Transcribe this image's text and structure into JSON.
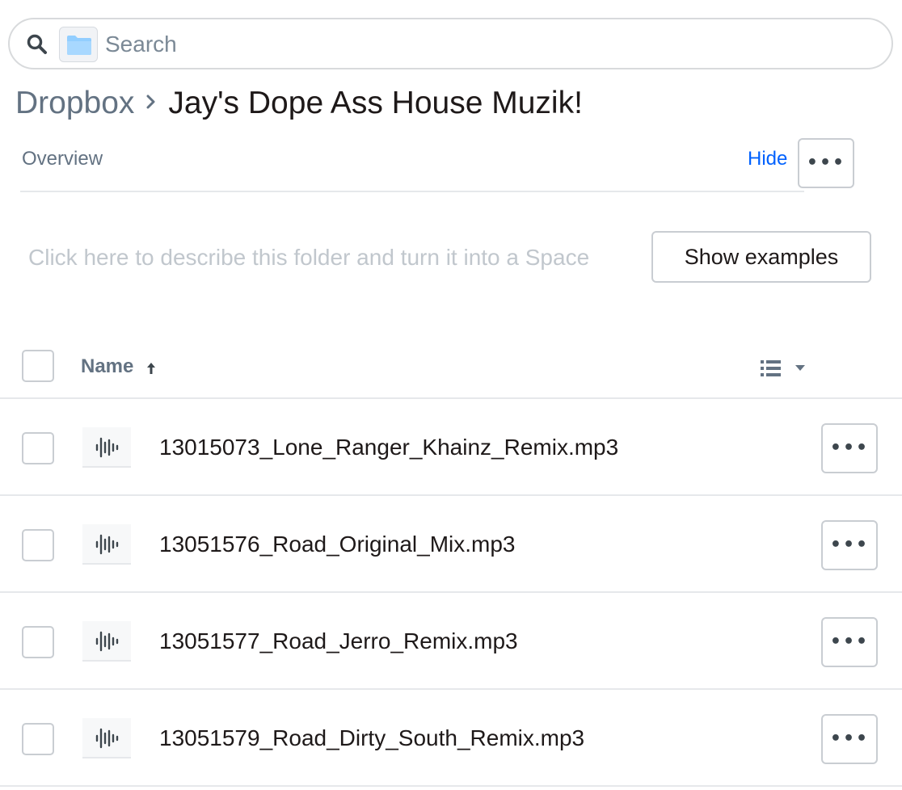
{
  "search": {
    "placeholder": "Search",
    "value": ""
  },
  "breadcrumb": {
    "root": "Dropbox",
    "current": "Jay's Dope Ass House Muzik!"
  },
  "overview": {
    "label": "Overview",
    "hide_label": "Hide",
    "more_label": "•••"
  },
  "description": {
    "prompt": "Click here to describe this folder and turn it into a Space",
    "show_examples_label": "Show examples"
  },
  "table": {
    "name_header": "Name",
    "sort_direction": "ascending"
  },
  "files": [
    {
      "name": "13015073_Lone_Ranger_Khainz_Remix.mp3",
      "icon": "audio-file-icon",
      "more_label": "•••"
    },
    {
      "name": "13051576_Road_Original_Mix.mp3",
      "icon": "audio-file-icon",
      "more_label": "•••"
    },
    {
      "name": "13051577_Road_Jerro_Remix.mp3",
      "icon": "audio-file-icon",
      "more_label": "•••"
    },
    {
      "name": "13051579_Road_Dirty_South_Remix.mp3",
      "icon": "audio-file-icon",
      "more_label": "•••"
    }
  ],
  "colors": {
    "accent_link": "#0061fe",
    "muted_text": "#637282",
    "placeholder_text": "#c1c7cd",
    "folder_icon": "#92ceff",
    "border": "#c9cdd2"
  }
}
